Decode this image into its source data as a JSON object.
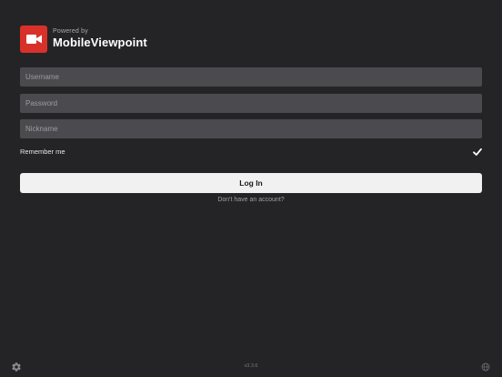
{
  "header": {
    "powered_by": "Powered by",
    "brand": "MobileViewpoint",
    "logo_icon": "video-camera-icon"
  },
  "form": {
    "username_placeholder": "Username",
    "password_placeholder": "Password",
    "nickname_placeholder": "Nickname",
    "username_value": "",
    "password_value": "",
    "nickname_value": "",
    "remember_label": "Remember me",
    "remember_checked": true,
    "login_label": "Log In",
    "signup_link": "Don't have an account?"
  },
  "footer": {
    "version": "v3.3.6",
    "settings_icon": "gear-icon",
    "language_icon": "globe-icon"
  },
  "colors": {
    "background": "#242427",
    "field": "#4b4b4f",
    "brand_red": "#d8312a",
    "button": "#f1f1f1"
  }
}
